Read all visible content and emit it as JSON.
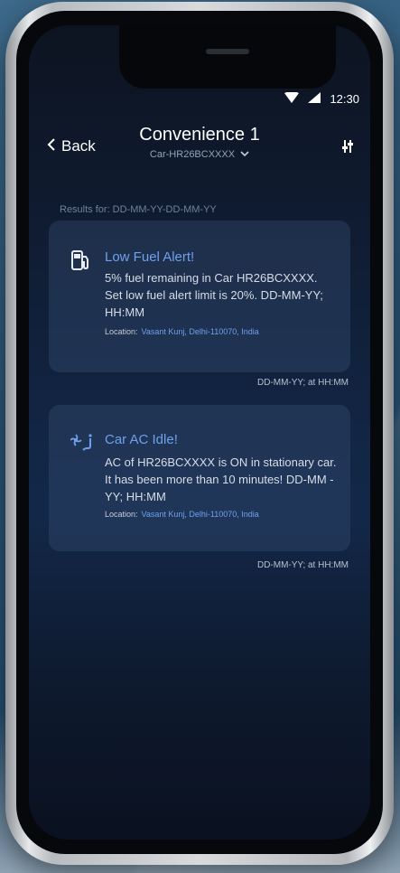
{
  "status_bar": {
    "time": "12:30"
  },
  "header": {
    "back_label": "Back",
    "title": "Convenience 1",
    "vehicle_selector": "Car-HR26BCXXXX"
  },
  "results_label": "Results for: DD-MM-YY-DD-MM-YY",
  "alerts": [
    {
      "icon": "fuel-pump-icon",
      "title": "Low Fuel Alert!",
      "body": "5% fuel remaining in Car HR26BCXXXX. Set low fuel alert limit is 20%. DD-MM-YY; HH:MM",
      "location_label": "Location:",
      "location_value": "Vasant Kunj, Delhi-110070, India",
      "timestamp": "DD-MM-YY; at HH:MM"
    },
    {
      "icon": "car-ac-icon",
      "title": "Car AC Idle!",
      "body": "AC of HR26BCXXXX is ON in stationary car. It has been more than 10 minutes! DD-MM -YY; HH:MM",
      "location_label": "Location:",
      "location_value": "Vasant Kunj, Delhi-110070, India",
      "timestamp": "DD-MM-YY; at HH:MM"
    }
  ],
  "colors": {
    "accent": "#6ea0ee",
    "screen_bg": "#0f1a2e",
    "card_bg": "#1f3350"
  }
}
